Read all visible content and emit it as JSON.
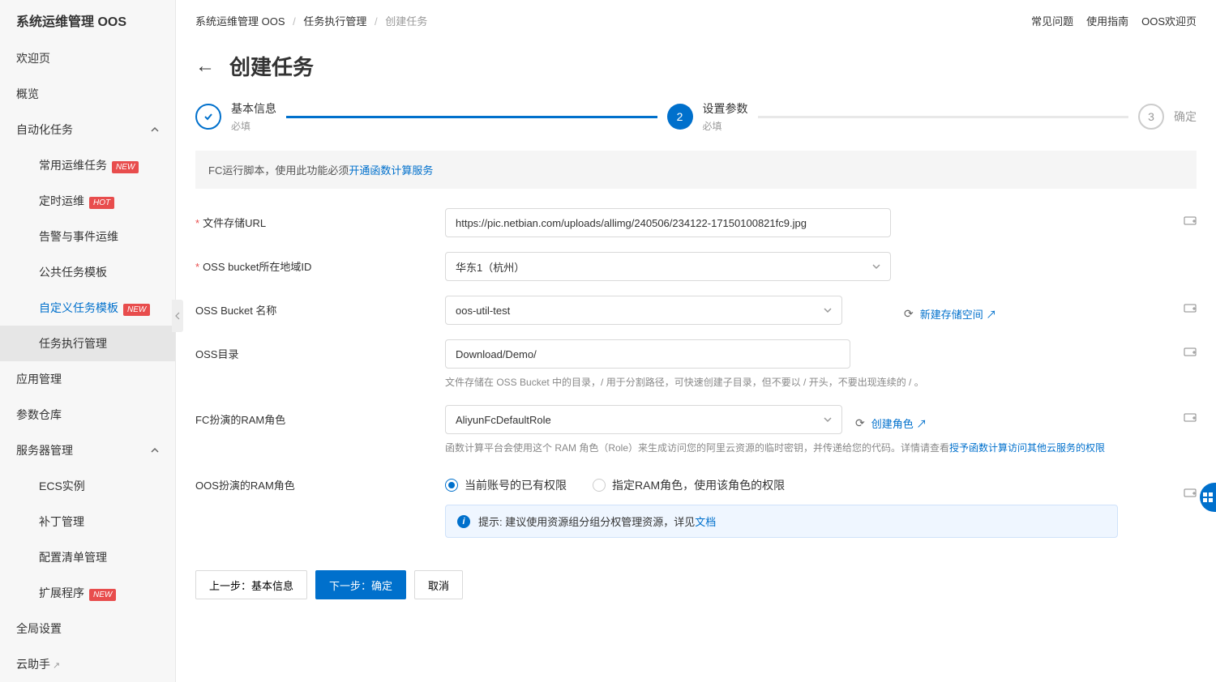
{
  "sidebar": {
    "title": "系统运维管理 OOS",
    "items": [
      {
        "label": "欢迎页"
      },
      {
        "label": "概览"
      },
      {
        "label": "自动化任务",
        "expanded": true
      },
      {
        "label": "常用运维任务",
        "badge": "NEW",
        "sub": true
      },
      {
        "label": "定时运维",
        "badge": "HOT",
        "sub": true
      },
      {
        "label": "告警与事件运维",
        "sub": true
      },
      {
        "label": "公共任务模板",
        "sub": true
      },
      {
        "label": "自定义任务模板",
        "badge": "NEW",
        "sub": true,
        "active": true
      },
      {
        "label": "任务执行管理",
        "sub": true,
        "selected": true
      },
      {
        "label": "应用管理"
      },
      {
        "label": "参数仓库"
      },
      {
        "label": "服务器管理",
        "expanded": true
      },
      {
        "label": "ECS实例",
        "sub": true
      },
      {
        "label": "补丁管理",
        "sub": true
      },
      {
        "label": "配置清单管理",
        "sub": true
      },
      {
        "label": "扩展程序",
        "badge": "NEW",
        "sub": true
      },
      {
        "label": "全局设置"
      },
      {
        "label": "云助手",
        "ext": true
      }
    ]
  },
  "breadcrumb": {
    "a": "系统运维管理 OOS",
    "b": "任务执行管理",
    "c": "创建任务"
  },
  "toplinks": {
    "faq": "常见问题",
    "guide": "使用指南",
    "welcome": "OOS欢迎页"
  },
  "page_title": "创建任务",
  "steps": {
    "s1": {
      "title": "基本信息",
      "sub": "必填"
    },
    "s2": {
      "num": "2",
      "title": "设置参数",
      "sub": "必填"
    },
    "s3": {
      "num": "3",
      "title": "确定"
    }
  },
  "notice": {
    "text": "FC运行脚本，使用此功能必须",
    "link": "开通函数计算服务"
  },
  "form": {
    "file_url": {
      "label": "文件存储URL",
      "value": "https://pic.netbian.com/uploads/allimg/240506/234122-17150100821fc9.jpg"
    },
    "region": {
      "label": "OSS bucket所在地域ID",
      "value": "华东1（杭州）"
    },
    "bucket": {
      "label": "OSS Bucket 名称",
      "value": "oos-util-test",
      "extra": "新建存储空间"
    },
    "dir": {
      "label": "OSS目录",
      "value": "Download/Demo/",
      "help": "文件存储在 OSS Bucket 中的目录，/ 用于分割路径，可快速创建子目录，但不要以 / 开头，不要出现连续的 / 。"
    },
    "fc_role": {
      "label": "FC扮演的RAM角色",
      "value": "AliyunFcDefaultRole",
      "extra": "创建角色",
      "help_a": "函数计算平台会使用这个 RAM 角色（Role）来生成访问您的阿里云资源的临时密钥，并传递给您的代码。详情请查看",
      "help_link": "授予函数计算访问其他云服务的权限"
    },
    "oos_role": {
      "label": "OOS扮演的RAM角色",
      "opt1": "当前账号的已有权限",
      "opt2": "指定RAM角色，使用该角色的权限",
      "tip_prefix": "提示: 建议使用资源组分组分权管理资源，详见",
      "tip_link": "文档"
    }
  },
  "buttons": {
    "prev": "上一步：基本信息",
    "next": "下一步：确定",
    "cancel": "取消"
  }
}
